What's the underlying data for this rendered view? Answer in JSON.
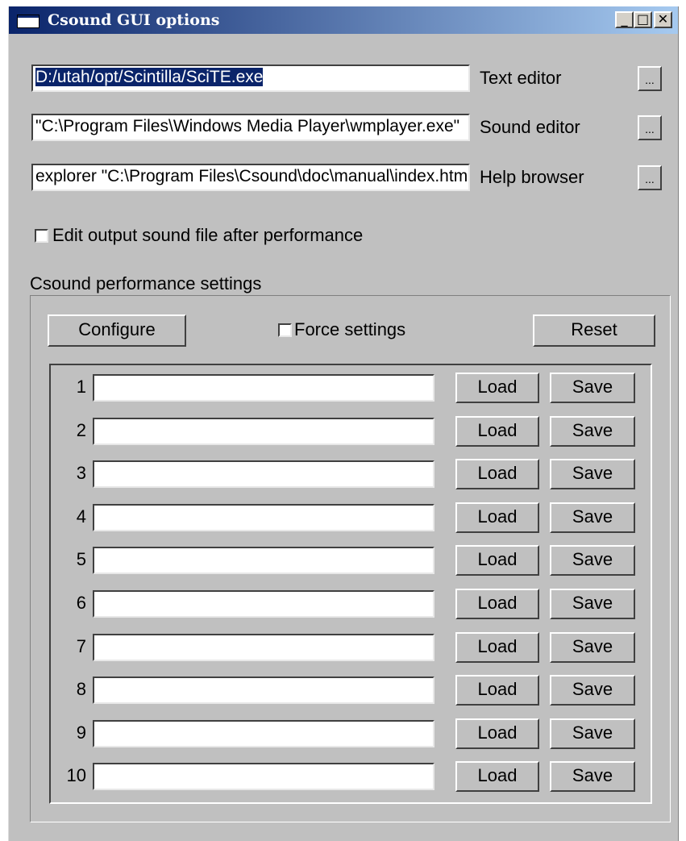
{
  "window": {
    "title": "Csound GUI options"
  },
  "title_buttons": {
    "minimize": "_",
    "maximize": "□",
    "close": "✕"
  },
  "paths": [
    {
      "value": "D:/utah/opt/Scintilla/SciTE.exe",
      "label": "Text editor",
      "browse": "..."
    },
    {
      "value": "\"C:\\Program Files\\Windows Media Player\\wmplayer.exe\"",
      "label": "Sound editor",
      "browse": "..."
    },
    {
      "value": "explorer \"C:\\Program Files\\Csound\\doc\\manual\\index.html\"",
      "label": "Help browser",
      "browse": "..."
    }
  ],
  "edit_output": {
    "label": "Edit output sound file after performance",
    "checked": false
  },
  "performance": {
    "group_label": "Csound performance settings",
    "configure_label": "Configure",
    "force_label": "Force settings",
    "force_checked": false,
    "reset_label": "Reset",
    "slots": [
      {
        "num": "1",
        "value": "",
        "load": "Load",
        "save": "Save"
      },
      {
        "num": "2",
        "value": "",
        "load": "Load",
        "save": "Save"
      },
      {
        "num": "3",
        "value": "",
        "load": "Load",
        "save": "Save"
      },
      {
        "num": "4",
        "value": "",
        "load": "Load",
        "save": "Save"
      },
      {
        "num": "5",
        "value": "",
        "load": "Load",
        "save": "Save"
      },
      {
        "num": "6",
        "value": "",
        "load": "Load",
        "save": "Save"
      },
      {
        "num": "7",
        "value": "",
        "load": "Load",
        "save": "Save"
      },
      {
        "num": "8",
        "value": "",
        "load": "Load",
        "save": "Save"
      },
      {
        "num": "9",
        "value": "",
        "load": "Load",
        "save": "Save"
      },
      {
        "num": "10",
        "value": "",
        "load": "Load",
        "save": "Save"
      }
    ]
  },
  "colors": {
    "face": "#c0c0c0",
    "title_start": "#0a246a",
    "title_end": "#a6caf0",
    "selection": "#0a246a"
  }
}
